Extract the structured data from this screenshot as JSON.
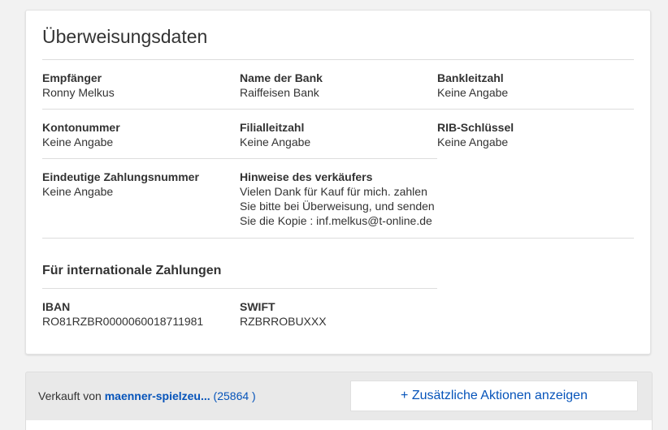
{
  "transfer": {
    "title": "Überweisungsdaten",
    "recipient": {
      "label": "Empfänger",
      "value": "Ronny Melkus"
    },
    "bank_name": {
      "label": "Name der Bank",
      "value": "Raiffeisen Bank"
    },
    "bank_code": {
      "label": "Bankleitzahl",
      "value": "Keine Angabe"
    },
    "account_number": {
      "label": "Kontonummer",
      "value": "Keine Angabe"
    },
    "branch_code": {
      "label": "Filialleitzahl",
      "value": "Keine Angabe"
    },
    "rib_key": {
      "label": "RIB-Schlüssel",
      "value": "Keine Angabe"
    },
    "payment_reference": {
      "label": "Eindeutige Zahlungsnummer",
      "value": "Keine Angabe"
    },
    "seller_notes": {
      "label": "Hinweise des verkäufers",
      "lines": [
        "Vielen Dank für Kauf für mich. zahlen",
        "Sie bitte bei Überweisung, und senden",
        "Sie die Kopie : inf.melkus@t-online.de"
      ]
    },
    "international": {
      "title": "Für internationale Zahlungen",
      "iban": {
        "label": "IBAN",
        "value": "RO81RZBR0000060018711981"
      },
      "swift": {
        "label": "SWIFT",
        "value": "RZBRROBUXXX"
      }
    }
  },
  "seller": {
    "prefix": "Verkauft von",
    "name": "maenner-spielzeu...",
    "score_open": "(",
    "score": "25864",
    "score_close": ")",
    "actions_button": "+ Zusätzliche Aktionen anzeigen"
  }
}
